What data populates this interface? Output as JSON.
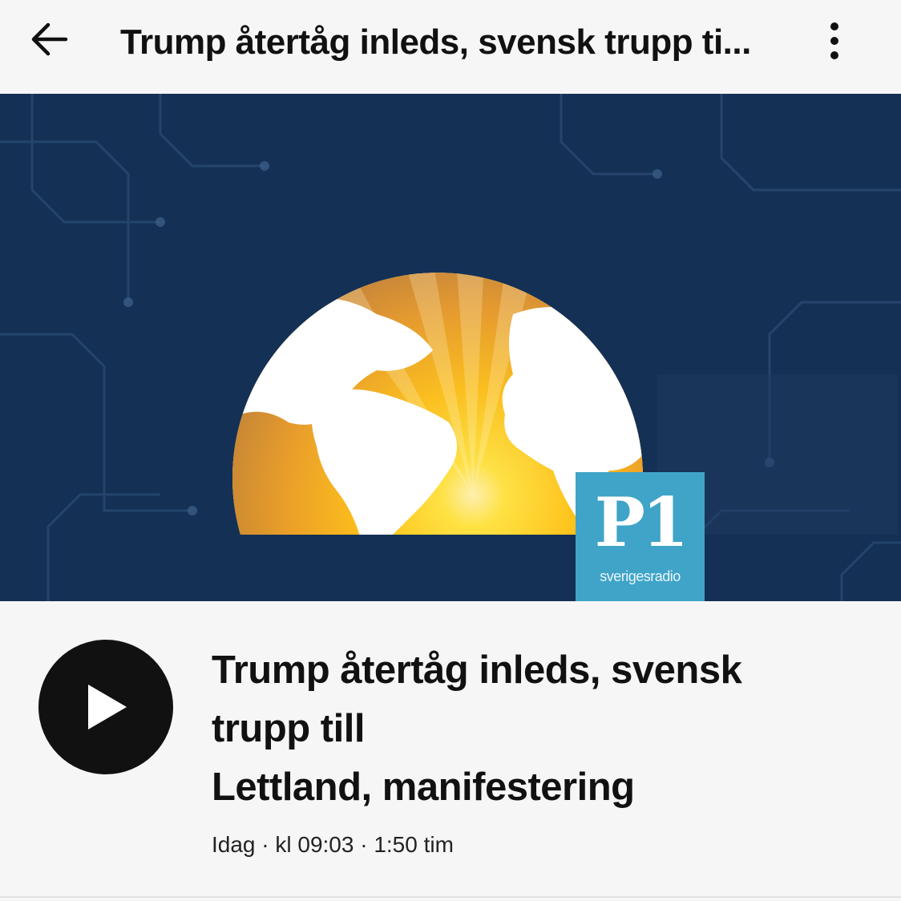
{
  "header": {
    "title": "Trump återtåg inleds, svensk trupp ti...",
    "back_icon": "arrow-left-icon",
    "menu_icon": "more-vertical-icon"
  },
  "artwork": {
    "logo_mark": "P1",
    "logo_brand": "sverigesradio",
    "colors": {
      "background": "#143055",
      "logo": "#3fa4c8",
      "sun": "#ffd21a"
    }
  },
  "episode": {
    "title_lines": [
      "Trump återtåg inleds, svensk",
      "trupp till",
      "Lettland, manifestering"
    ],
    "meta": "Idag · kl 09:03 · 1:50 tim",
    "play_icon": "play-icon"
  }
}
